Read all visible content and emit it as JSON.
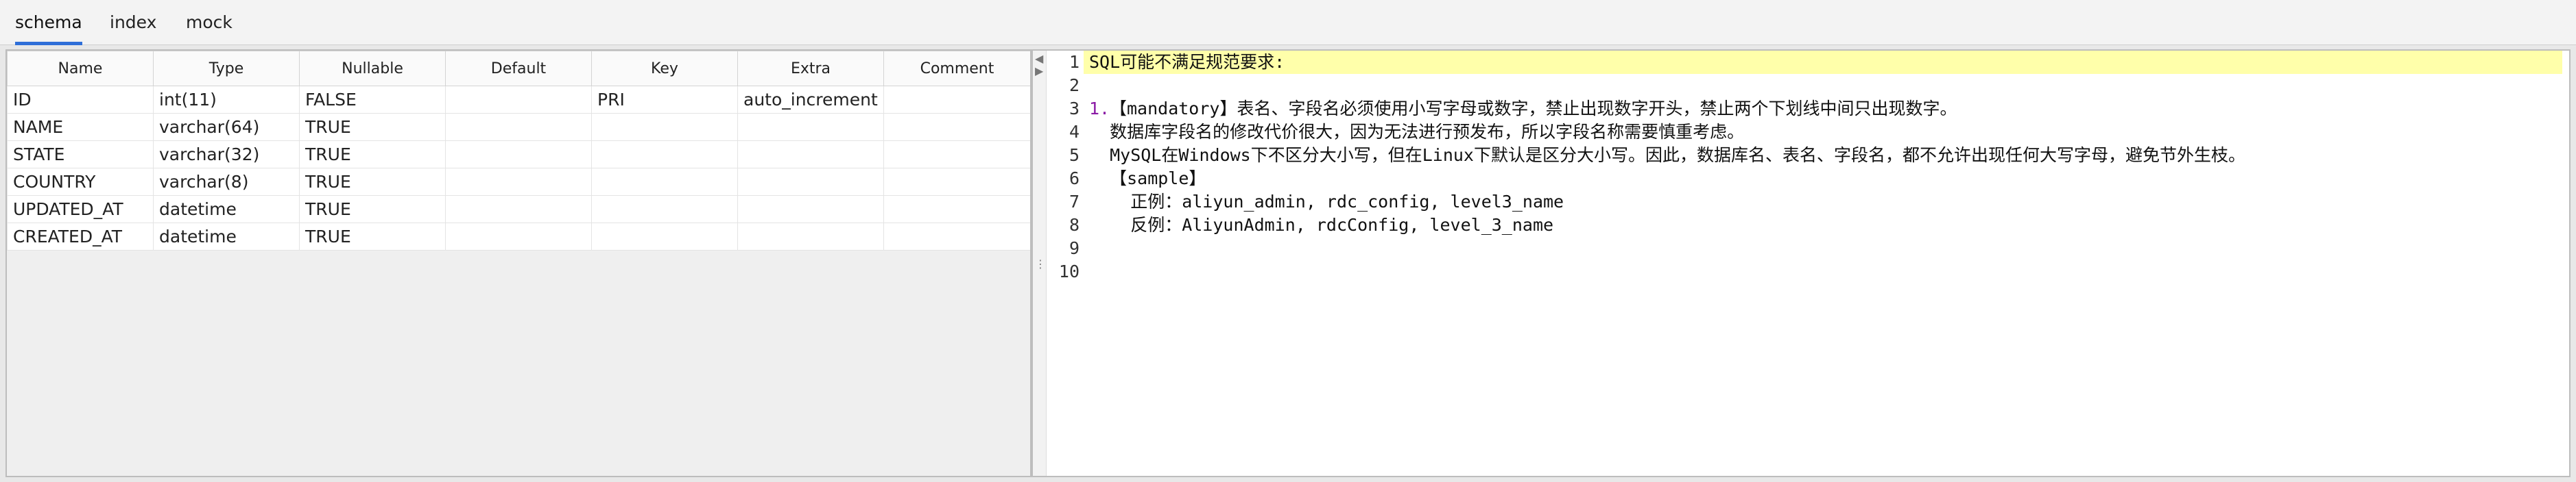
{
  "tabs": [
    {
      "label": "schema",
      "active": true
    },
    {
      "label": "index",
      "active": false
    },
    {
      "label": "mock",
      "active": false
    }
  ],
  "schema": {
    "columns": [
      "Name",
      "Type",
      "Nullable",
      "Default",
      "Key",
      "Extra",
      "Comment"
    ],
    "rows": [
      [
        "ID",
        "int(11)",
        "FALSE",
        "",
        "PRI",
        "auto_increment",
        ""
      ],
      [
        "NAME",
        "varchar(64)",
        "TRUE",
        "",
        "",
        "",
        ""
      ],
      [
        "STATE",
        "varchar(32)",
        "TRUE",
        "",
        "",
        "",
        ""
      ],
      [
        "COUNTRY",
        "varchar(8)",
        "TRUE",
        "",
        "",
        "",
        ""
      ],
      [
        "UPDATED_AT",
        "datetime",
        "TRUE",
        "",
        "",
        "",
        ""
      ],
      [
        "CREATED_AT",
        "datetime",
        "TRUE",
        "",
        "",
        "",
        ""
      ]
    ]
  },
  "editor": {
    "highlight_color": "#ffffaa",
    "lines": [
      {
        "n": "1",
        "text": "SQL可能不满足规范要求:"
      },
      {
        "n": "2",
        "text": ""
      },
      {
        "n": "3",
        "prefix": "1.",
        "text": "【mandatory】表名、字段名必须使用小写字母或数字，禁止出现数字开头，禁止两个下划线中间只出现数字。"
      },
      {
        "n": "4",
        "text": "  数据库字段名的修改代价很大，因为无法进行预发布，所以字段名称需要慎重考虑。"
      },
      {
        "n": "5",
        "text": "  MySQL在Windows下不区分大小写，但在Linux下默认是区分大小写。因此，数据库名、表名、字段名，都不允许出现任何大写字母，避免节外生枝。"
      },
      {
        "n": "6",
        "text": "  【sample】"
      },
      {
        "n": "7",
        "text": "    正例：aliyun_admin, rdc_config, level3_name"
      },
      {
        "n": "8",
        "text": "    反例：AliyunAdmin, rdcConfig, level_3_name"
      },
      {
        "n": "9",
        "text": ""
      },
      {
        "n": "10",
        "text": ""
      }
    ]
  }
}
